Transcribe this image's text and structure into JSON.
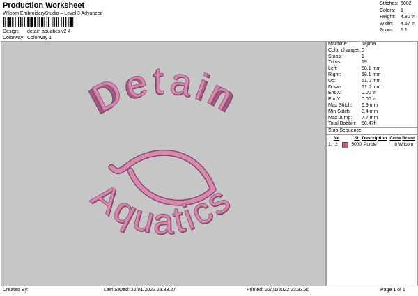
{
  "header": {
    "title": "Production Worksheet",
    "subtitle": "Wilcom EmbroideryStudio – Level 3 Advanced",
    "design_label": "Design:",
    "design_value": "detain aquatics v2 4",
    "colorway_label": "Colorway:",
    "colorway_value": "Colorway 1"
  },
  "stats": [
    {
      "k": "Stitches:",
      "v": "5002"
    },
    {
      "k": "Colors:",
      "v": "1"
    },
    {
      "k": "Height:",
      "v": "4.80 in"
    },
    {
      "k": "Width:",
      "v": "4.57 in"
    },
    {
      "k": "Zoom:",
      "v": "1:1"
    }
  ],
  "artwork": {
    "top_text": "Detain",
    "bottom_text": "Aquatics",
    "thread_color": "#d889b0",
    "thread_shadow": "#a15a80"
  },
  "machine": [
    {
      "k": "Machine:",
      "v": "Tajima"
    },
    {
      "k": "Color changes:",
      "v": "0"
    },
    {
      "k": "Stops:",
      "v": "1"
    },
    {
      "k": "Trims:",
      "v": "19"
    },
    {
      "k": "Left:",
      "v": "58.1 mm"
    },
    {
      "k": "Right:",
      "v": "58.1 mm"
    },
    {
      "k": "Up:",
      "v": "61.0 mm"
    },
    {
      "k": "Down:",
      "v": "61.0 mm"
    },
    {
      "k": "EndX:",
      "v": "0.00 in"
    },
    {
      "k": "EndY:",
      "v": "0.00 in"
    },
    {
      "k": "Max Stitch:",
      "v": "6.9 mm"
    },
    {
      "k": "Min Stitch:",
      "v": "0.4 mm"
    },
    {
      "k": "Max Jump:",
      "v": "7.7 mm"
    },
    {
      "k": "Total Bobbin:",
      "v": "50.47ft"
    }
  ],
  "stop_sequence": {
    "label": "Stop Sequence:",
    "columns": [
      "N#",
      "St.",
      "Description",
      "Code",
      "Brand"
    ],
    "rows": [
      {
        "idx": "1.",
        "n": "2",
        "st": "5000",
        "desc": "Purple",
        "code": "8",
        "brand": "Wilcom",
        "swatch": "#c25a9a"
      }
    ]
  },
  "footer": {
    "created": "Created By:",
    "saved": "Last Saved: 22/01/2022 23.33.27",
    "printed": "Printed: 22/01/2022 23.33.30",
    "page": "Page 1 of 1"
  }
}
